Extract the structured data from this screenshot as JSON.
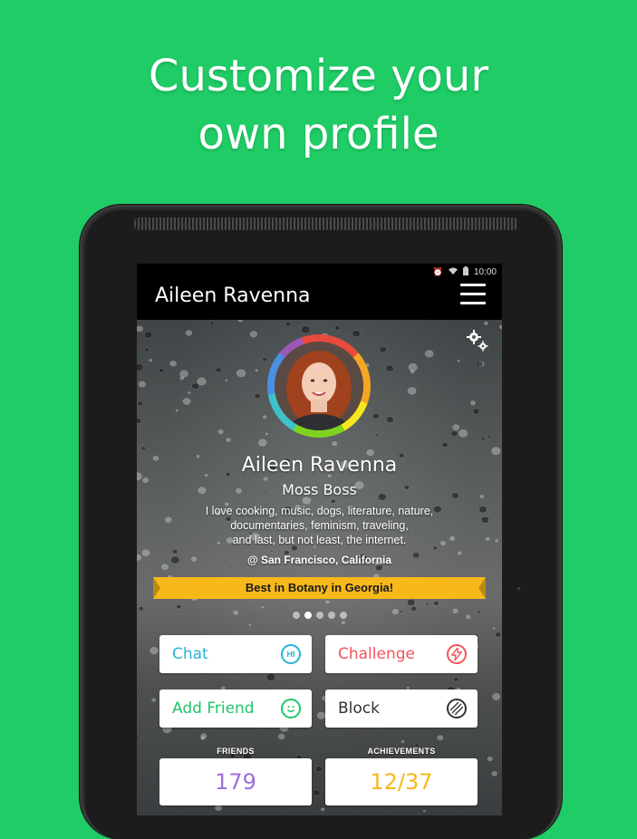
{
  "promo": {
    "line1": "Customize your",
    "line2": "own profile"
  },
  "statusbar": {
    "time": "10:00"
  },
  "appbar": {
    "title": "Aileen Ravenna"
  },
  "profile": {
    "name": "Aileen Ravenna",
    "subtitle": "Moss Boss",
    "bio_line1": "I love cooking, music, dogs, literature, nature,",
    "bio_line2": "documentaries, feminism, traveling,",
    "bio_line3": "and last, but not least, the internet.",
    "location": "@ San Francisco, California",
    "badge": "Best in Botany in Georgia!"
  },
  "carousel": {
    "count": 5,
    "active_index": 1
  },
  "actions": {
    "chat": {
      "label": "Chat",
      "icon_text": "HI",
      "color": "#2ab3d6"
    },
    "challenge": {
      "label": "Challenge",
      "color": "#f2545b"
    },
    "add_friend": {
      "label": "Add Friend",
      "color": "#1fc66a"
    },
    "block": {
      "label": "Block",
      "color": "#333333"
    }
  },
  "stats": {
    "friends_label": "FRIENDS",
    "friends_value": "179",
    "friends_color": "#9b6fe0",
    "achievements_label": "ACHIEVEMENTS",
    "achievements_value": "12/37",
    "achievements_color": "#f7b81a"
  },
  "colors": {
    "background": "#1fcc66",
    "ribbon": "#f7b81a"
  }
}
